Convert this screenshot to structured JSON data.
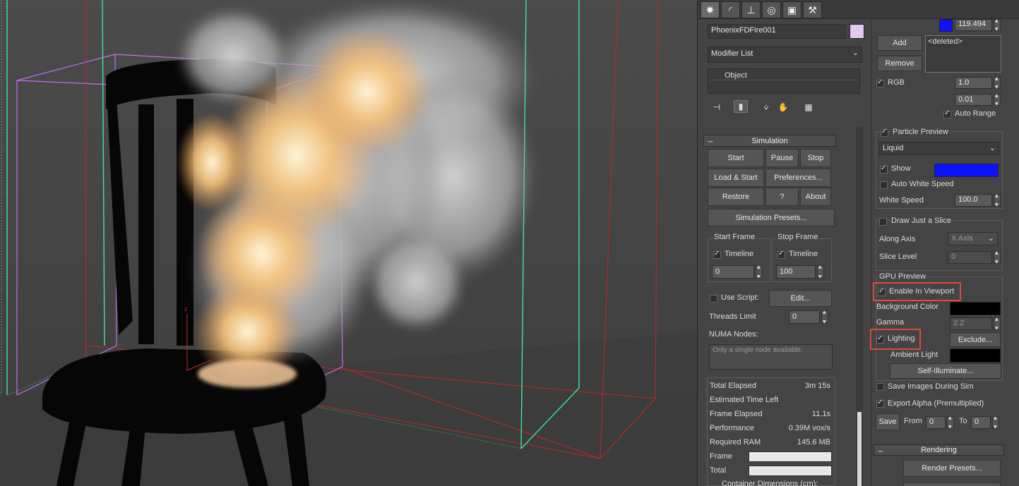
{
  "command_panel": {
    "tabs": [
      {
        "icon": "create-icon",
        "glyph": "✸"
      },
      {
        "icon": "modify-icon",
        "glyph": "◜"
      },
      {
        "icon": "hierarchy-icon",
        "glyph": "⊥"
      },
      {
        "icon": "motion-icon",
        "glyph": "◎"
      },
      {
        "icon": "display-icon",
        "glyph": "▣"
      },
      {
        "icon": "utilities-icon",
        "glyph": "⚒"
      }
    ],
    "object_name": "PhoenixFDFire001",
    "object_color": "#e6c8f0",
    "modifier_list": "Modifier List",
    "stack_item": "Object"
  },
  "simulation": {
    "title": "Simulation",
    "collapse": "_",
    "buttons": {
      "start": "Start",
      "pause": "Pause",
      "stop": "Stop",
      "load_start": "Load & Start",
      "preferences": "Preferences...",
      "restore": "Restore",
      "help": "?",
      "about": "About",
      "presets": "Simulation Presets...",
      "edit": "Edit..."
    },
    "start_frame": {
      "label": "Start Frame",
      "timeline": "Timeline",
      "value": "0"
    },
    "stop_frame": {
      "label": "Stop Frame",
      "timeline": "Timeline",
      "value": "100"
    },
    "use_script": "Use Script:",
    "threads_limit": {
      "label": "Threads Limit",
      "value": "0"
    },
    "numa_nodes": {
      "label": "NUMA Nodes:",
      "placeholder": "Only a single node available."
    },
    "stats": [
      {
        "label": "Total Elapsed",
        "value": "3m 15s"
      },
      {
        "label": "Estimated Time Left",
        "value": ""
      },
      {
        "label": "Frame Elapsed",
        "value": "11.1s"
      },
      {
        "label": "Performance",
        "value": "0.39M vox/s"
      },
      {
        "label": "Required RAM",
        "value": "145.6 MB"
      }
    ],
    "frame_label": "Frame",
    "total_label": "Total",
    "container_dimensions": "Container Dimensions (cm):"
  },
  "preview": {
    "top_value": "119.494",
    "add": "Add",
    "remove": "Remove",
    "list_item": "<deleted>",
    "rgb": "RGB",
    "rgb_value1": "1.0",
    "rgb_value2": "0.01",
    "auto_range": "Auto Range",
    "particle_preview": "Particle Preview",
    "particle_type": "Liquid",
    "show": "Show",
    "auto_white_speed": "Auto White Speed",
    "white_speed": {
      "label": "White Speed",
      "value": "100.0"
    },
    "draw_slice": "Draw Just a Slice",
    "along_axis": {
      "label": "Along Axis",
      "value": "X Axis"
    },
    "slice_level": {
      "label": "Slice Level",
      "value": "0"
    },
    "gpu_preview": "GPU Preview",
    "enable_in_viewport": "Enable In Viewport",
    "background_color": "Background Color",
    "gamma": {
      "label": "Gamma",
      "value": "2.2"
    },
    "lighting": "Lighting",
    "exclude": "Exclude...",
    "ambient_light": "Ambient Light",
    "self_illuminate": "Self-Illuminate...",
    "save_images": "Save Images During Sim",
    "export_alpha": "Export Alpha (Premultiplied)",
    "save": "Save",
    "from": {
      "label": "From",
      "value": "0"
    },
    "to": {
      "label": "To",
      "value": "0"
    }
  },
  "rendering": {
    "title": "Rendering",
    "collapse": "_",
    "render_presets": "Render Presets..."
  },
  "colors": {
    "accent_highlight": "#e0493c",
    "particle_color": "#0a12ff",
    "top_swatch": "#1010ff",
    "background_color": "#000000",
    "ambient_color": "#000000"
  }
}
